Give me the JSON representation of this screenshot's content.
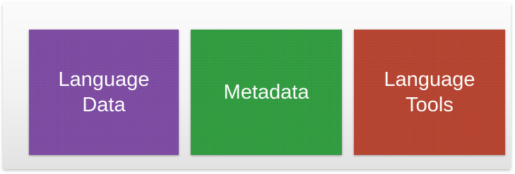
{
  "boxes": [
    {
      "label": "Language\nData",
      "color": "#7c4aa1"
    },
    {
      "label": "Metadata",
      "color": "#2f9b3e"
    },
    {
      "label": "Language\nTools",
      "color": "#b5422e"
    }
  ]
}
